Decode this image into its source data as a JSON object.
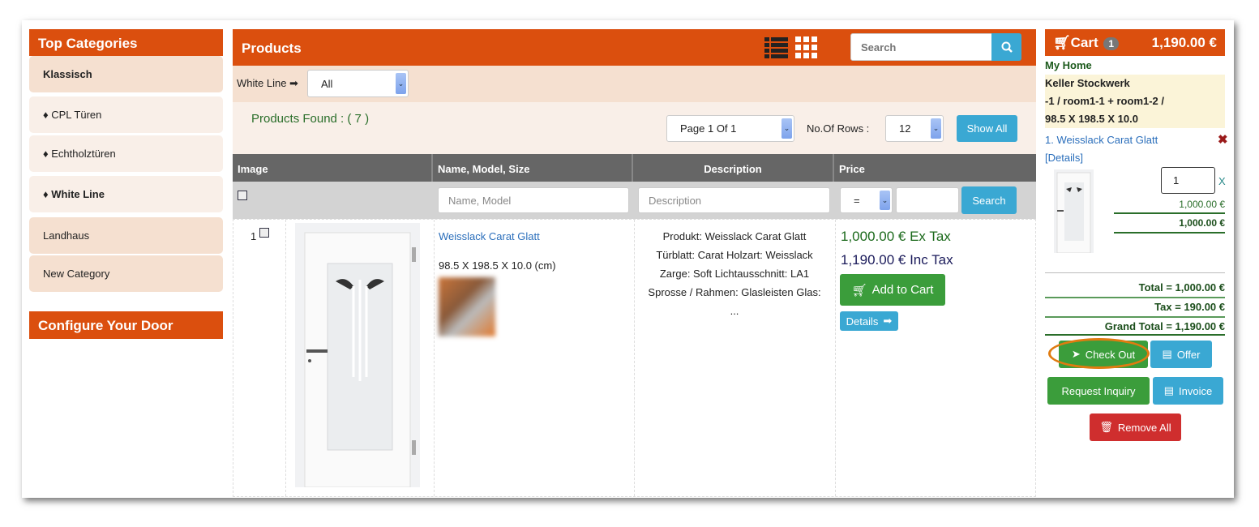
{
  "sidebar": {
    "title": "Top Categories",
    "items": [
      {
        "label": "Klassisch",
        "bold": true
      },
      {
        "label": "♦ CPL Türen"
      },
      {
        "label": "♦ Echtholztüren"
      },
      {
        "label": "♦ White Line",
        "bold": true
      },
      {
        "label": "Landhaus"
      },
      {
        "label": "New Category"
      }
    ],
    "configure": "Configure Your Door"
  },
  "products": {
    "title": "Products",
    "search_placeholder": "Search",
    "filter_label": "White Line",
    "filter_value": "All",
    "found": "Products Found : ( 7 )",
    "page_select": "Page 1 Of 1",
    "rows_label": "No.Of Rows  :",
    "rows_value": "12",
    "show_all": "Show All",
    "columns": [
      "Image",
      "Name, Model, Size",
      "Description",
      "Price"
    ],
    "filters": {
      "name_placeholder": "Name, Model",
      "desc_placeholder": "Description",
      "op": "=",
      "search": "Search"
    },
    "rows": [
      {
        "index": "1",
        "name": "Weisslack Carat Glatt",
        "size": "98.5 X 198.5 X 10.0 (cm)",
        "description": [
          "Produkt: Weisslack Carat Glatt",
          "Türblatt: Carat Holzart: Weisslack",
          "Zarge: Soft Lichtausschnitt: LA1",
          "Sprosse / Rahmen: Glasleisten Glas:",
          "..."
        ],
        "price_ex": "1,000.00 € Ex Tax",
        "price_inc": "1,190.00 € Inc Tax",
        "add": "Add to Cart",
        "details": "Details"
      }
    ]
  },
  "cart": {
    "title": "Cart",
    "count": "1",
    "total_header": "1,190.00 €",
    "home": "My Home",
    "location": [
      "Keller Stockwerk",
      "-1 / room1-1 + room1-2 /",
      "98.5 X 198.5 X 10.0"
    ],
    "item": "1. Weisslack Carat Glatt",
    "details": "[Details]",
    "qty": "1",
    "x": "X",
    "unit": "1,000.00 €",
    "line_total": "1,000.00 €",
    "total": "Total = 1,000.00 €",
    "tax": "Tax = 190.00 €",
    "grand": "Grand Total = 1,190.00 €",
    "buttons": {
      "checkout": "Check Out",
      "offer": "Offer",
      "inquiry": "Request Inquiry",
      "invoice": "Invoice",
      "remove": "Remove All"
    }
  },
  "colors": {
    "brand": "#db4f0e",
    "green": "#3b9d3b",
    "blue": "#3aa8d3",
    "red": "#cf2e2e",
    "highlight": "#e07b10"
  }
}
